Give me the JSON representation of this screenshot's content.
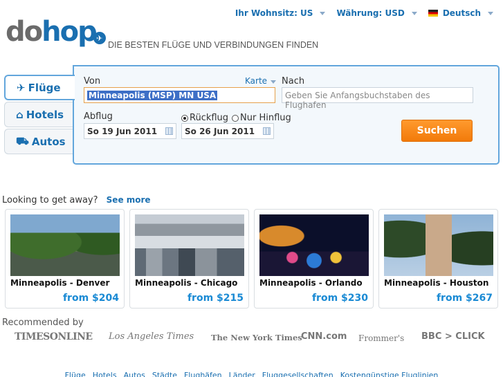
{
  "topbar": {
    "residence": "Ihr Wohnsitz: US",
    "currency": "Währung: USD",
    "language": "Deutsch"
  },
  "logo": {
    "part1": "do",
    "part2": "hop"
  },
  "tagline": "DIE BESTEN FLÜGE UND VERBINDUNGEN FINDEN",
  "tabs": [
    {
      "label": "Flüge",
      "icon": "plane-icon"
    },
    {
      "label": "Hotels",
      "icon": "house-icon"
    },
    {
      "label": "Autos",
      "icon": "car-icon"
    }
  ],
  "search": {
    "from_label": "Von",
    "map_link": "Karte",
    "from_value": "Minneapolis (MSP) MN USA",
    "to_label": "Nach",
    "to_placeholder": "Geben Sie Anfangsbuchstaben des Flughafen",
    "depart_label": "Abflug",
    "depart_value": "So 19 Jun 2011",
    "return_option": "Rückflug",
    "oneway_option": "Nur Hinflug",
    "return_value": "So 26 Jun 2011",
    "search_button": "Suchen"
  },
  "deals": {
    "heading": "Looking to get away?",
    "see_more": "See more",
    "items": [
      {
        "route": "Minneapolis - Denver",
        "price": "from $204"
      },
      {
        "route": "Minneapolis - Chicago",
        "price": "from $215"
      },
      {
        "route": "Minneapolis - Orlando",
        "price": "from $230"
      },
      {
        "route": "Minneapolis - Houston",
        "price": "from $267"
      }
    ]
  },
  "recommended": {
    "heading": "Recommended by",
    "sources": [
      "TIMESONLINE",
      "Los Angeles Times",
      "The New York Times",
      "CNN.com",
      "Frommer's",
      "BBC > CLICK"
    ]
  },
  "footer": {
    "links": [
      "Flüge",
      "Hotels",
      "Autos",
      "Städte",
      "Flughäfen",
      "Länder",
      "Fluggesellschaften",
      "Kostengünstige Fluglinien"
    ]
  },
  "colors": {
    "brand_blue": "#1a6fb0",
    "button_orange": "#f27a0a",
    "price_blue": "#1a8ad4"
  }
}
